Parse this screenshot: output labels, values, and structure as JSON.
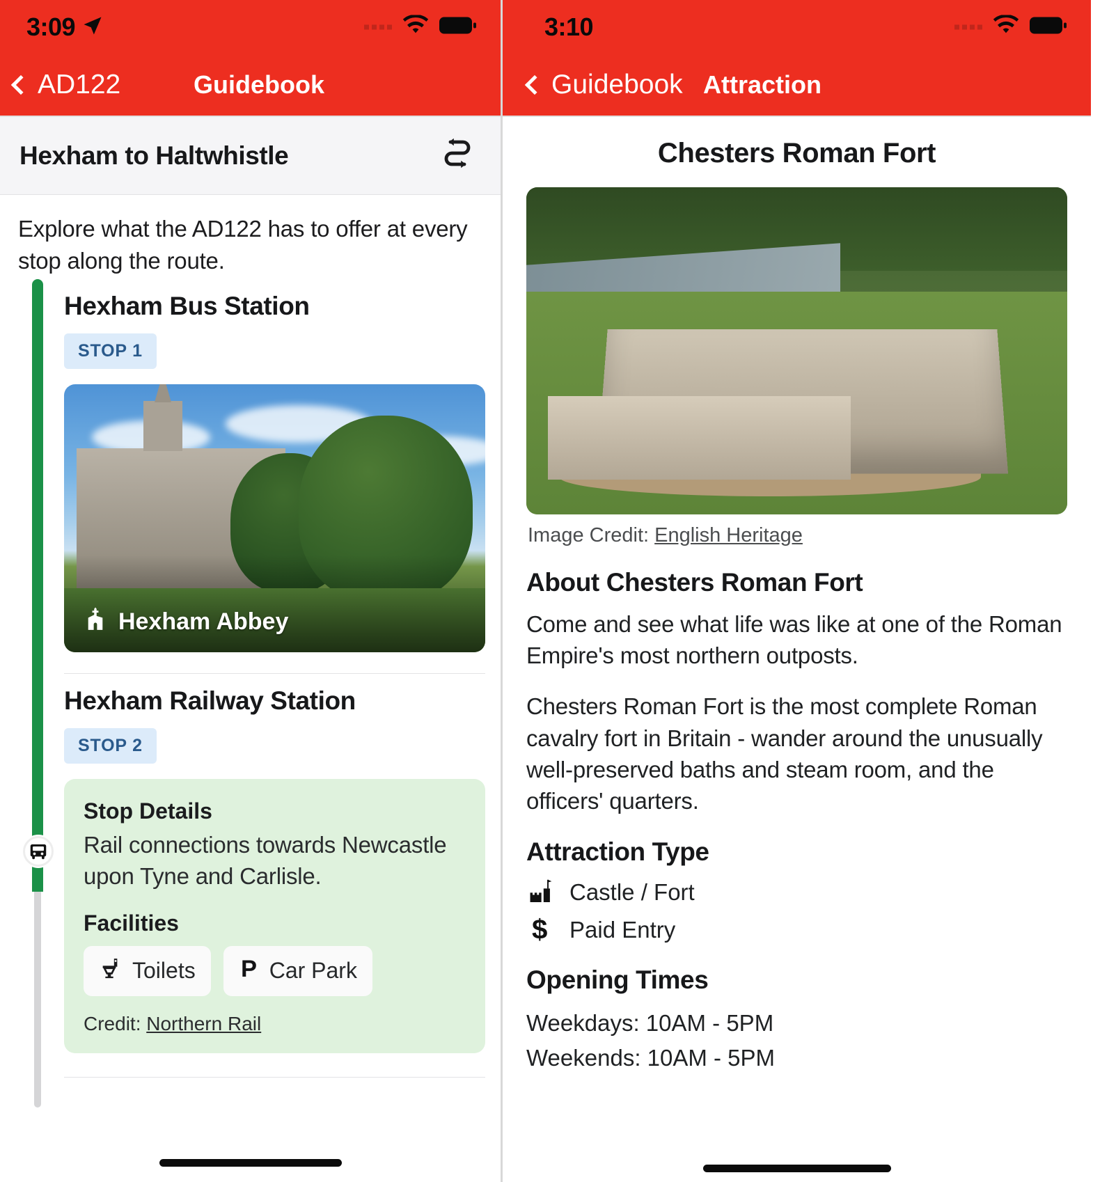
{
  "theme": {
    "accent": "#ED2E20",
    "green_rail": "#1B9148",
    "badge_bg": "#DCEBFA",
    "badge_fg": "#2A5A8C",
    "card_bg": "#DFF2DD"
  },
  "left": {
    "status": {
      "time": "3:09",
      "location_icon": "location-arrow-icon",
      "wifi_icon": "wifi-icon",
      "battery_icon": "battery-icon"
    },
    "nav": {
      "back_label": "AD122",
      "title": "Guidebook"
    },
    "route_header": {
      "title": "Hexham to Haltwhistle",
      "swap_icon": "swap-route-icon"
    },
    "intro": "Explore what the AD122 has to offer at every stop along the route.",
    "stops": [
      {
        "name": "Hexham Bus Station",
        "badge": "STOP 1",
        "photo": {
          "caption": "Hexham Abbey",
          "icon": "church-icon"
        }
      },
      {
        "name": "Hexham Railway Station",
        "badge": "STOP 2",
        "details_heading": "Stop Details",
        "details_text": "Rail connections towards Newcastle upon Tyne and Carlisle.",
        "facilities_heading": "Facilities",
        "facilities": [
          {
            "label": "Toilets",
            "icon": "toilet-icon"
          },
          {
            "label": "Car Park",
            "icon": "parking-icon"
          }
        ],
        "credit_prefix": "Credit:",
        "credit_link": "Northern Rail"
      }
    ],
    "marker_icon": "bus-marker-icon"
  },
  "right": {
    "status": {
      "time": "3:10",
      "wifi_icon": "wifi-icon",
      "battery_icon": "battery-icon"
    },
    "nav": {
      "back_label": "Guidebook",
      "title": "Attraction"
    },
    "title": "Chesters Roman Fort",
    "image_credit_prefix": "Image Credit:",
    "image_credit_link": "English Heritage",
    "about_heading": "About Chesters Roman Fort",
    "about_paragraphs": [
      "Come and see what life was like at one of the Roman Empire's most northern outposts.",
      "Chesters Roman Fort is the most complete Roman cavalry fort in Britain - wander around the unusually well-preserved baths and steam room, and the officers' quarters."
    ],
    "attraction_type_heading": "Attraction Type",
    "attraction_types": [
      {
        "label": "Castle / Fort",
        "icon": "castle-icon"
      },
      {
        "label": "Paid Entry",
        "icon": "dollar-icon"
      }
    ],
    "opening_times_heading": "Opening Times",
    "opening_times": [
      "Weekdays: 10AM - 5PM",
      "Weekends: 10AM - 5PM"
    ]
  }
}
